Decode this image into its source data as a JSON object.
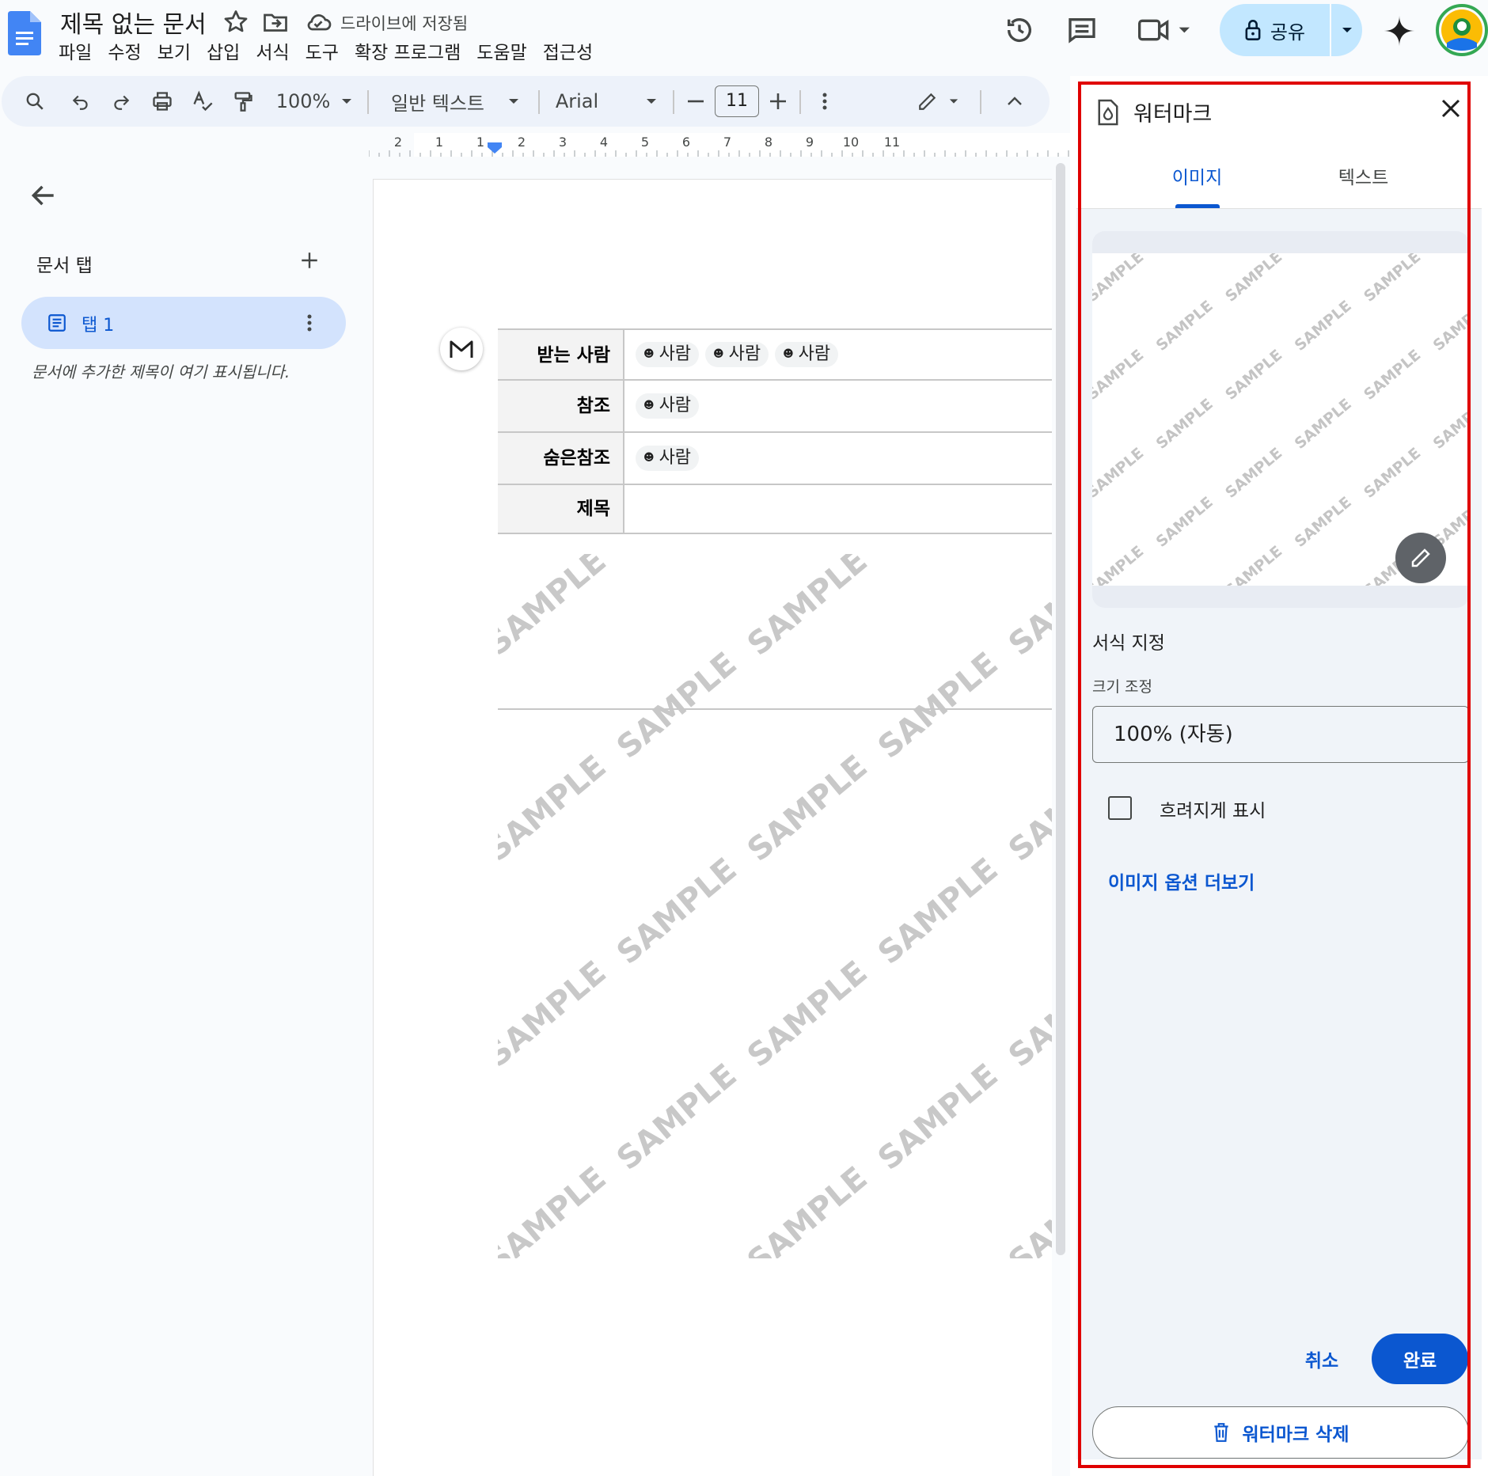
{
  "header": {
    "doc_title": "제목 없는 문서",
    "saved_status": "드라이브에 저장됨",
    "share_label": "공유",
    "menu": [
      "파일",
      "수정",
      "보기",
      "삽입",
      "서식",
      "도구",
      "확장 프로그램",
      "도움말",
      "접근성"
    ],
    "icons": [
      "docs-logo",
      "star-icon",
      "move-folder-icon",
      "cloud-saved-icon",
      "history-icon",
      "comment-icon",
      "meet-icon",
      "lock-icon",
      "gemini-icon",
      "avatar"
    ]
  },
  "toolbar": {
    "zoom": "100%",
    "style": "일반 텍스트",
    "font": "Arial",
    "font_size": "11"
  },
  "ruler": {
    "numbers": [
      "2",
      "1",
      "1",
      "2",
      "3",
      "4",
      "5",
      "6",
      "7",
      "8",
      "9",
      "10",
      "11"
    ]
  },
  "left_panel": {
    "heading": "문서 탭",
    "tab_label": "탭 1",
    "hint": "문서에 추가한 제목이 여기 표시됩니다."
  },
  "email_draft": {
    "rows": [
      {
        "label": "받는 사람",
        "chips": [
          "사람",
          "사람",
          "사람"
        ]
      },
      {
        "label": "참조",
        "chips": [
          "사람"
        ]
      },
      {
        "label": "숨은참조",
        "chips": [
          "사람"
        ]
      },
      {
        "label": "제목",
        "chips": []
      }
    ]
  },
  "watermark": {
    "text": "SAMPLE",
    "side_panel": {
      "title": "워터마크",
      "tab_image": "이미지",
      "tab_text": "텍스트",
      "format_heading": "서식 지정",
      "scale_label": "크기 조정",
      "scale_value": "100% (자동)",
      "fade_label": "흐려지게 표시",
      "fade_checked": false,
      "more_options": "이미지 옵션 더보기",
      "cancel": "취소",
      "done": "완료",
      "delete": "워터마크 삭제"
    }
  },
  "colors": {
    "accent": "#0b57d0",
    "share_bg": "#c2e7ff",
    "tab_selected_bg": "#d3e3fd",
    "highlight": "#e00000"
  }
}
